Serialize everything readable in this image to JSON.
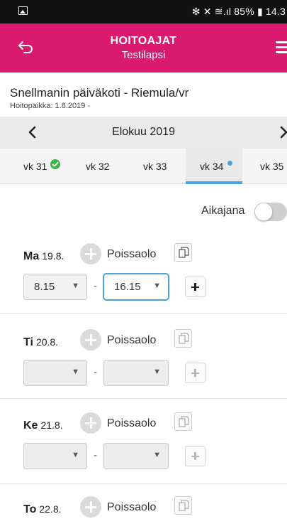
{
  "status_bar": {
    "text": "✻ ✕ ≋.ıl 85% ▮ 14.3"
  },
  "header": {
    "title": "HOITOAJAT",
    "subtitle": "Testilapsi"
  },
  "location": {
    "name": "Snellmanin päiväkoti - Riemula/vr",
    "placement": "Hoitopaikka: 1.8.2019 -"
  },
  "month": "Elokuu 2019",
  "weeks": [
    {
      "label": "vk 31",
      "status": "confirmed"
    },
    {
      "label": "vk 32"
    },
    {
      "label": "vk 33"
    },
    {
      "label": "vk 34",
      "status": "current",
      "active": true
    },
    {
      "label": "vk 35"
    }
  ],
  "timeline": {
    "label": "Aikajana",
    "enabled": false
  },
  "days": [
    {
      "weekday": "Ma",
      "date": "19.8.",
      "absence_label": "Poissaolo",
      "start": "8.15",
      "end": "16.15"
    },
    {
      "weekday": "Ti",
      "date": "20.8.",
      "absence_label": "Poissaolo",
      "start": "",
      "end": ""
    },
    {
      "weekday": "Ke",
      "date": "21.8.",
      "absence_label": "Poissaolo",
      "start": "",
      "end": ""
    },
    {
      "weekday": "To",
      "date": "22.8.",
      "absence_label": "Poissaolo"
    }
  ],
  "time_separator": "-",
  "colors": {
    "header": "#d91a6f",
    "accent": "#4aa3df",
    "check": "#3bb54a"
  }
}
